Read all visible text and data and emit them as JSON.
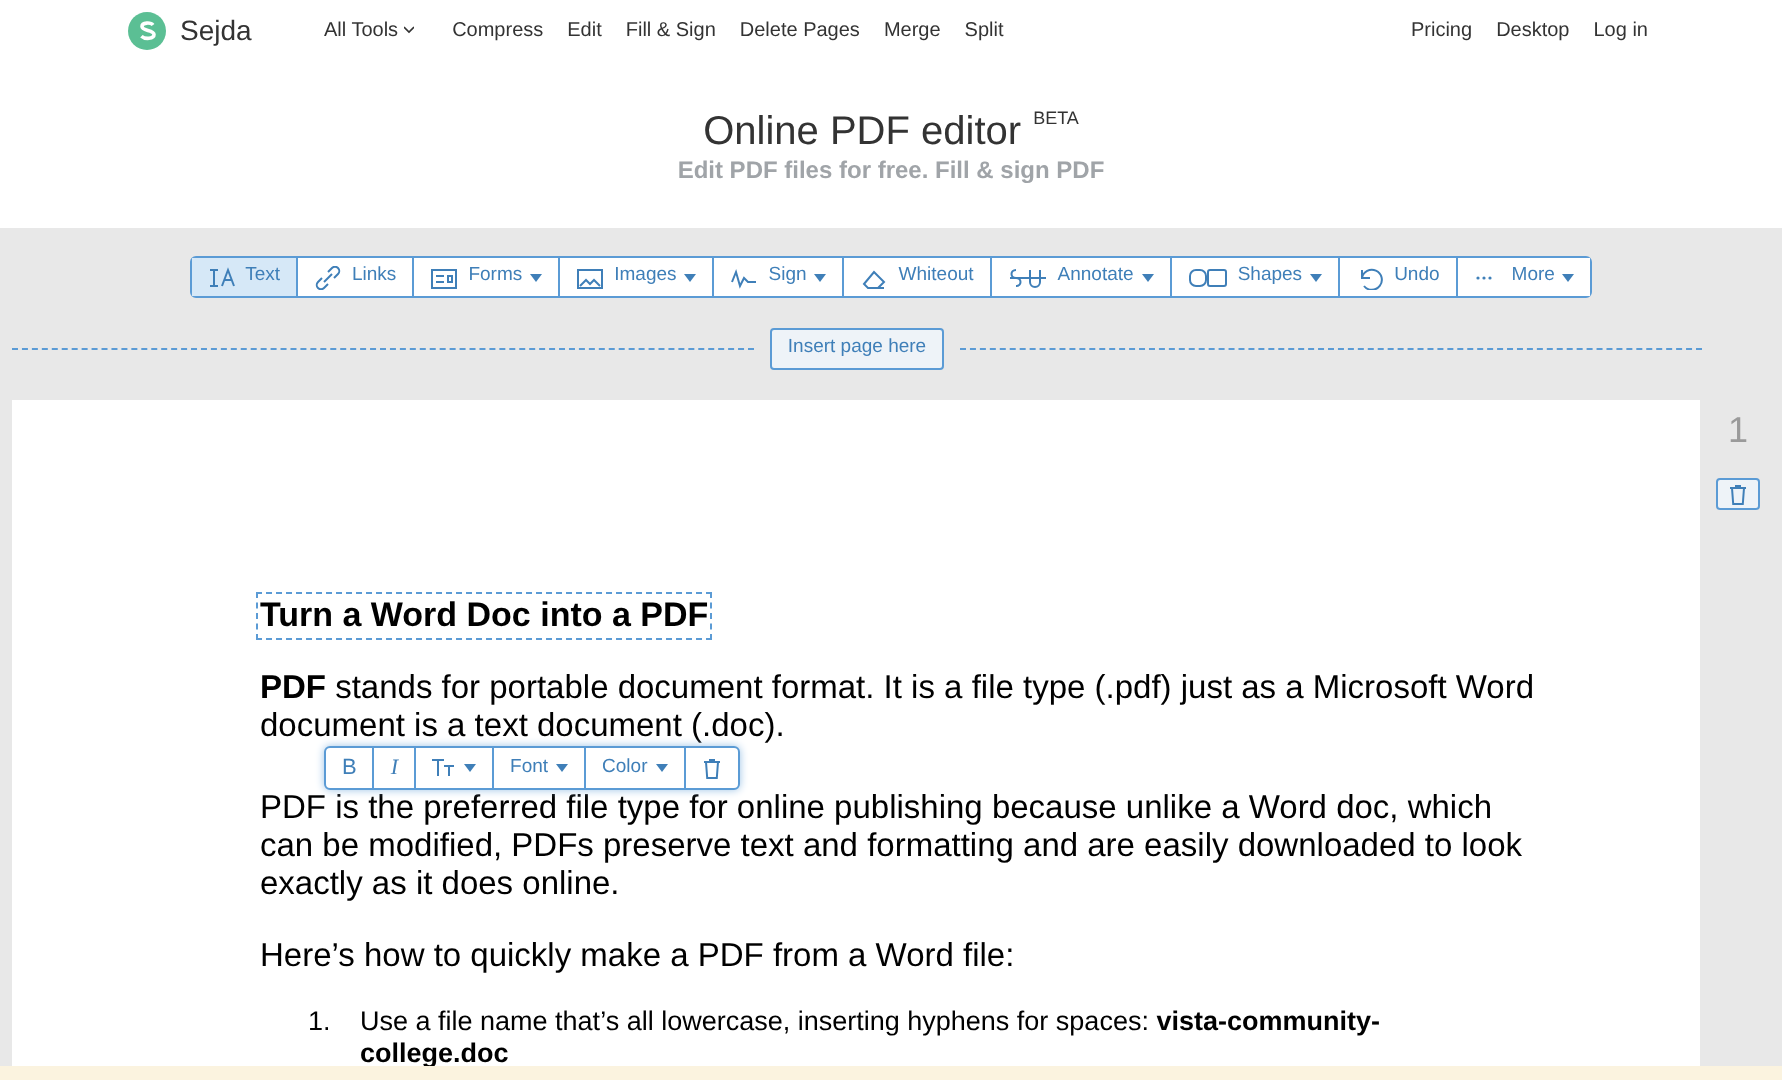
{
  "nav": {
    "logo": "Sejda",
    "links": [
      {
        "label": "All Tools",
        "dropdown": true
      },
      {
        "label": "Compress",
        "dropdown": false
      },
      {
        "label": "Edit",
        "dropdown": false
      },
      {
        "label": "Fill & Sign",
        "dropdown": false
      },
      {
        "label": "Delete Pages",
        "dropdown": false
      },
      {
        "label": "Merge",
        "dropdown": false
      },
      {
        "label": "Split",
        "dropdown": false
      }
    ],
    "right_links": [
      "Pricing",
      "Desktop",
      "Log in"
    ]
  },
  "header": {
    "title": "Online PDF editor",
    "badge": "BETA",
    "subtitle": "Edit PDF files for free. Fill & sign PDF"
  },
  "toolbar": [
    {
      "label": "Text",
      "dropdown": false,
      "selected": true
    },
    {
      "label": "Links",
      "dropdown": false,
      "selected": false
    },
    {
      "label": "Forms",
      "dropdown": true,
      "selected": false
    },
    {
      "label": "Images",
      "dropdown": true,
      "selected": false
    },
    {
      "label": "Sign",
      "dropdown": true,
      "selected": false
    },
    {
      "label": "Whiteout",
      "dropdown": false,
      "selected": false
    },
    {
      "label": "Annotate",
      "dropdown": true,
      "selected": false
    },
    {
      "label": "Shapes",
      "dropdown": true,
      "selected": false
    },
    {
      "label": "Undo",
      "dropdown": false,
      "selected": false
    },
    {
      "label": "More",
      "dropdown": true,
      "selected": false
    }
  ],
  "insert_button": "Insert page here",
  "page": {
    "number": "1",
    "heading": "Turn a Word Doc into a PDF",
    "paragraphs": [
      "**PDF** stands for portable document format. It is a file type (.pdf) just as a Microsoft Word document is a text document (.doc).",
      "PDF is the preferred file type for online publishing because unlike a Word doc, which can be modified, PDFs preserve text and formatting and are easily downloaded to look exactly as it does online.",
      "Here’s how to quickly make a PDF from a Word file:"
    ],
    "list": [
      {
        "number": "1.",
        "text": "Use a file name that’s all lowercase, inserting hyphens for spaces: **vista-community-college.doc**"
      }
    ]
  },
  "format_toolbar": [
    {
      "kind": "bold",
      "label": "B"
    },
    {
      "kind": "italic",
      "label": "I"
    },
    {
      "kind": "size"
    },
    {
      "kind": "menu",
      "label": "Font"
    },
    {
      "kind": "menu",
      "label": "Color"
    },
    {
      "kind": "delete"
    }
  ]
}
